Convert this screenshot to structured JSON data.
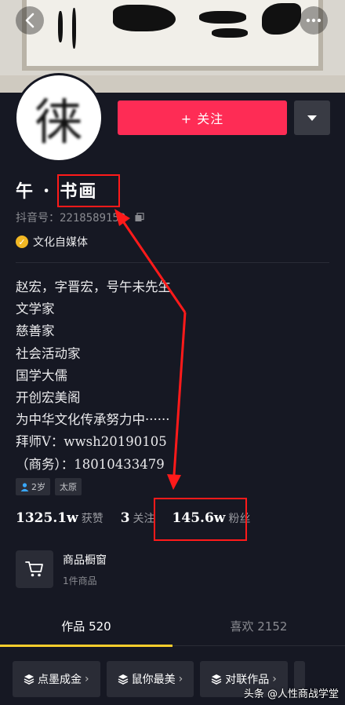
{
  "header": {
    "back_icon": "back-chevron-icon",
    "more_icon": "ellipsis-icon"
  },
  "profile": {
    "avatar_char": "徕",
    "follow_label": "+ 关注",
    "name": "午 ･ 书画",
    "douyin_id": "抖音号：2218589158",
    "verification": "文化自媒体"
  },
  "bio": [
    "赵宏，字晋宏，号午未先生",
    "文学家",
    "慈善家",
    "社会活动家",
    "国学大儒",
    "开创宏美阁",
    "为中华文化传承努力中······",
    "拜师V：wwsh20190105",
    "（商务）：18010433479"
  ],
  "tags": [
    {
      "label": "2岁",
      "icon": "person-icon"
    },
    {
      "label": "太原"
    }
  ],
  "stats": [
    {
      "num": "1325.1w",
      "label": "获赞"
    },
    {
      "num": "3",
      "label": "关注"
    },
    {
      "num": "145.6w",
      "label": "粉丝"
    }
  ],
  "shop": {
    "title": "商品橱窗",
    "subtitle": "1件商品",
    "icon": "shopping-cart-icon"
  },
  "tabs": [
    {
      "label": "作品 520",
      "active": true
    },
    {
      "label": "喜欢 2152",
      "active": false
    }
  ],
  "collections": [
    {
      "label": "点墨成金"
    },
    {
      "label": "鼠你最美"
    },
    {
      "label": "对联作品"
    }
  ],
  "watermark": "头条 @人性商战学堂",
  "colors": {
    "background": "#161823",
    "follow_button": "#fe2c55",
    "tab_indicator": "#facd2c",
    "annotation": "#ff1a1a",
    "verify_badge": "#f2b824"
  }
}
